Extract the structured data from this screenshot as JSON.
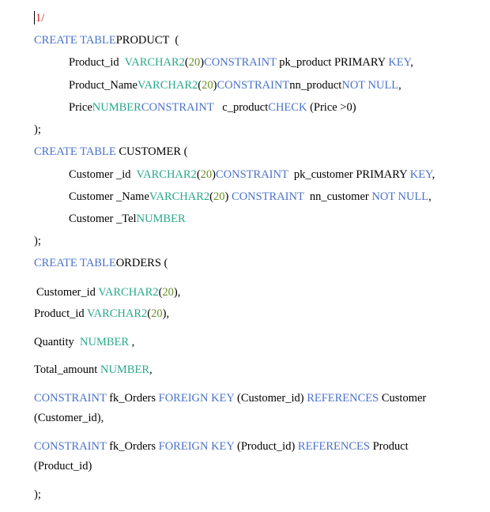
{
  "document": {
    "lines": [
      {
        "id": "marker",
        "segments": [
          {
            "t": "1/",
            "c": "r"
          }
        ]
      },
      {
        "id": "product-create",
        "segments": [
          {
            "t": "CREATE TABLE",
            "c": "k"
          },
          {
            "t": "PRODUCT  (",
            "c": "p"
          }
        ]
      },
      {
        "id": "product-id",
        "segments": [
          {
            "t": "Product_id  ",
            "c": "p"
          },
          {
            "t": "VARCHAR2",
            "c": "t"
          },
          {
            "t": "(",
            "c": "p"
          },
          {
            "t": "20",
            "c": "n"
          },
          {
            "t": ")",
            "c": "p"
          },
          {
            "t": "CONSTRAINT",
            "c": "k"
          },
          {
            "t": " pk_product PRIMARY ",
            "c": "p"
          },
          {
            "t": "KEY",
            "c": "k"
          },
          {
            "t": ",",
            "c": "p"
          }
        ]
      },
      {
        "id": "product-name",
        "segments": [
          {
            "t": "Product_Name",
            "c": "p"
          },
          {
            "t": "VARCHAR2",
            "c": "t"
          },
          {
            "t": "(",
            "c": "p"
          },
          {
            "t": "20",
            "c": "n"
          },
          {
            "t": ")",
            "c": "p"
          },
          {
            "t": "CONSTRAINT",
            "c": "k"
          },
          {
            "t": "nn_product",
            "c": "p"
          },
          {
            "t": "NOT NULL",
            "c": "k"
          },
          {
            "t": ",",
            "c": "p"
          }
        ]
      },
      {
        "id": "product-price",
        "segments": [
          {
            "t": "Price",
            "c": "p"
          },
          {
            "t": "NUMBER",
            "c": "t"
          },
          {
            "t": "CONSTRAINT",
            "c": "k"
          },
          {
            "t": "   c_product",
            "c": "p"
          },
          {
            "t": "CHECK",
            "c": "k"
          },
          {
            "t": " (Price >0)",
            "c": "p"
          }
        ]
      },
      {
        "id": "product-close",
        "segments": [
          {
            "t": ");",
            "c": "p"
          }
        ]
      },
      {
        "id": "customer-create",
        "segments": [
          {
            "t": "CREATE TABLE",
            "c": "k"
          },
          {
            "t": " CUSTOMER (",
            "c": "p"
          }
        ]
      },
      {
        "id": "customer-id",
        "segments": [
          {
            "t": "Customer _id  ",
            "c": "p"
          },
          {
            "t": "VARCHAR2",
            "c": "t"
          },
          {
            "t": "(",
            "c": "p"
          },
          {
            "t": "20",
            "c": "n"
          },
          {
            "t": ")",
            "c": "p"
          },
          {
            "t": "CONSTRAINT",
            "c": "k"
          },
          {
            "t": "  pk_customer PRIMARY ",
            "c": "p"
          },
          {
            "t": "KEY",
            "c": "k"
          },
          {
            "t": ",",
            "c": "p"
          }
        ]
      },
      {
        "id": "customer-name",
        "segments": [
          {
            "t": "Customer _Name",
            "c": "p"
          },
          {
            "t": "VARCHAR2",
            "c": "t"
          },
          {
            "t": "(",
            "c": "p"
          },
          {
            "t": "20",
            "c": "n"
          },
          {
            "t": ") ",
            "c": "p"
          },
          {
            "t": "CONSTRAINT",
            "c": "k"
          },
          {
            "t": "  nn_customer ",
            "c": "p"
          },
          {
            "t": "NOT NULL",
            "c": "k"
          },
          {
            "t": ",",
            "c": "p"
          }
        ]
      },
      {
        "id": "customer-tel",
        "segments": [
          {
            "t": "Customer _Tel",
            "c": "p"
          },
          {
            "t": "NUMBER",
            "c": "t"
          }
        ]
      },
      {
        "id": "customer-close",
        "segments": [
          {
            "t": ");",
            "c": "p"
          }
        ]
      },
      {
        "id": "orders-create",
        "segments": [
          {
            "t": "CREATE TABLE",
            "c": "k"
          },
          {
            "t": "ORDERS (",
            "c": "p"
          }
        ]
      },
      {
        "id": "orders-customer-id",
        "segments": [
          {
            "t": "Customer_id ",
            "c": "p"
          },
          {
            "t": "VARCHAR2",
            "c": "t"
          },
          {
            "t": "(",
            "c": "p"
          },
          {
            "t": "20",
            "c": "n"
          },
          {
            "t": "),",
            "c": "p"
          }
        ]
      },
      {
        "id": "orders-product-id",
        "segments": [
          {
            "t": "Product_id ",
            "c": "p"
          },
          {
            "t": "VARCHAR2",
            "c": "t"
          },
          {
            "t": "(",
            "c": "p"
          },
          {
            "t": "20",
            "c": "n"
          },
          {
            "t": "),",
            "c": "p"
          }
        ]
      },
      {
        "id": "orders-quantity",
        "segments": [
          {
            "t": "Quantity  ",
            "c": "p"
          },
          {
            "t": "NUMBER",
            "c": "t"
          },
          {
            "t": " ,",
            "c": "p"
          }
        ]
      },
      {
        "id": "orders-total",
        "segments": [
          {
            "t": "Total_amount ",
            "c": "p"
          },
          {
            "t": "NUMBER",
            "c": "t"
          },
          {
            "t": ",",
            "c": "p"
          }
        ]
      },
      {
        "id": "orders-fk1-a",
        "segments": [
          {
            "t": "CONSTRAINT",
            "c": "k"
          },
          {
            "t": " fk_Orders ",
            "c": "p"
          },
          {
            "t": "FOREIGN KEY",
            "c": "k"
          },
          {
            "t": " (Customer_id) ",
            "c": "p"
          },
          {
            "t": "REFERENCES",
            "c": "k"
          },
          {
            "t": " Customer",
            "c": "p"
          }
        ]
      },
      {
        "id": "orders-fk1-b",
        "segments": [
          {
            "t": "(Customer_id),",
            "c": "p"
          }
        ]
      },
      {
        "id": "orders-fk2-a",
        "segments": [
          {
            "t": "CONSTRAINT",
            "c": "k"
          },
          {
            "t": " fk_Orders ",
            "c": "p"
          },
          {
            "t": "FOREIGN KEY",
            "c": "k"
          },
          {
            "t": " (Product_id) ",
            "c": "p"
          },
          {
            "t": "REFERENCES",
            "c": "k"
          },
          {
            "t": " Product",
            "c": "p"
          }
        ]
      },
      {
        "id": "orders-fk2-b",
        "segments": [
          {
            "t": "(Product_id)",
            "c": "p"
          }
        ]
      },
      {
        "id": "orders-close",
        "segments": [
          {
            "t": ");",
            "c": "p"
          }
        ]
      }
    ]
  },
  "colors": {
    "keyword": "#4a72c7",
    "datatype": "#2aa88b",
    "number": "#6b8e23",
    "plain": "#000000",
    "marker": "#cc2222"
  }
}
